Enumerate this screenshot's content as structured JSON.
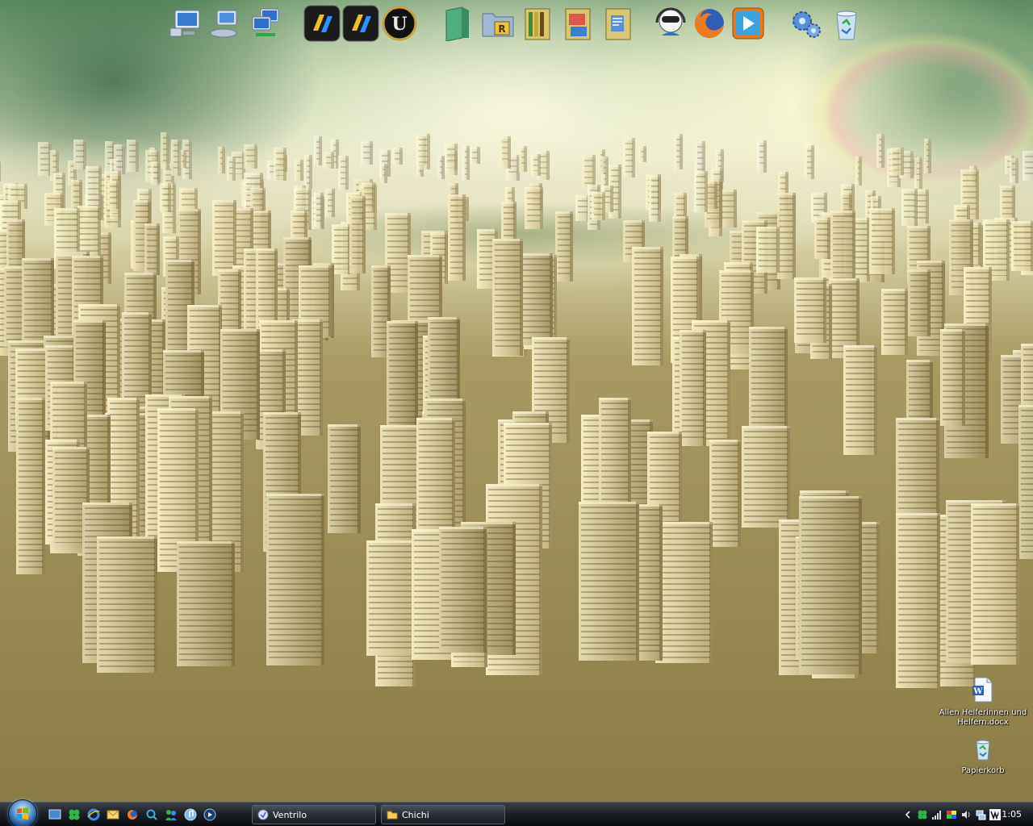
{
  "desktop": {
    "icons": [
      {
        "label": "Allen Helferinnen und Helfern.docx",
        "icon": "word-document-icon"
      },
      {
        "label": "Papierkorb",
        "icon": "recycle-bin-icon"
      }
    ]
  },
  "dock": {
    "icons": [
      "my-computer-icon",
      "network-places-icon",
      "network-connections-icon",
      "cs-game-icon",
      "cs-game-alt-icon",
      "unreal-tournament-icon",
      "green-folder-icon",
      "winrar-folder-icon",
      "books-folder-icon",
      "pictures-folder-icon",
      "documents-folder-icon",
      "messenger-icon",
      "firefox-icon",
      "media-player-icon",
      "settings-gears-icon",
      "recycle-bin-icon"
    ]
  },
  "taskbar": {
    "quick_launch": [
      "show-desktop-icon",
      "clover-icon",
      "internet-explorer-icon",
      "mail-icon",
      "firefox-icon",
      "search-icon",
      "messenger-icon",
      "itunes-icon",
      "media-player-icon"
    ],
    "buttons": [
      {
        "label": "Ventrilo",
        "icon": "ventrilo-icon"
      },
      {
        "label": "Chichi",
        "icon": "folder-icon"
      }
    ],
    "tray": {
      "icons": [
        "expand-arrow-icon",
        "clover-icon",
        "signal-icon",
        "color-bars-icon",
        "volume-icon",
        "network-icon",
        "winamp-icon"
      ],
      "time": "11:05"
    }
  }
}
